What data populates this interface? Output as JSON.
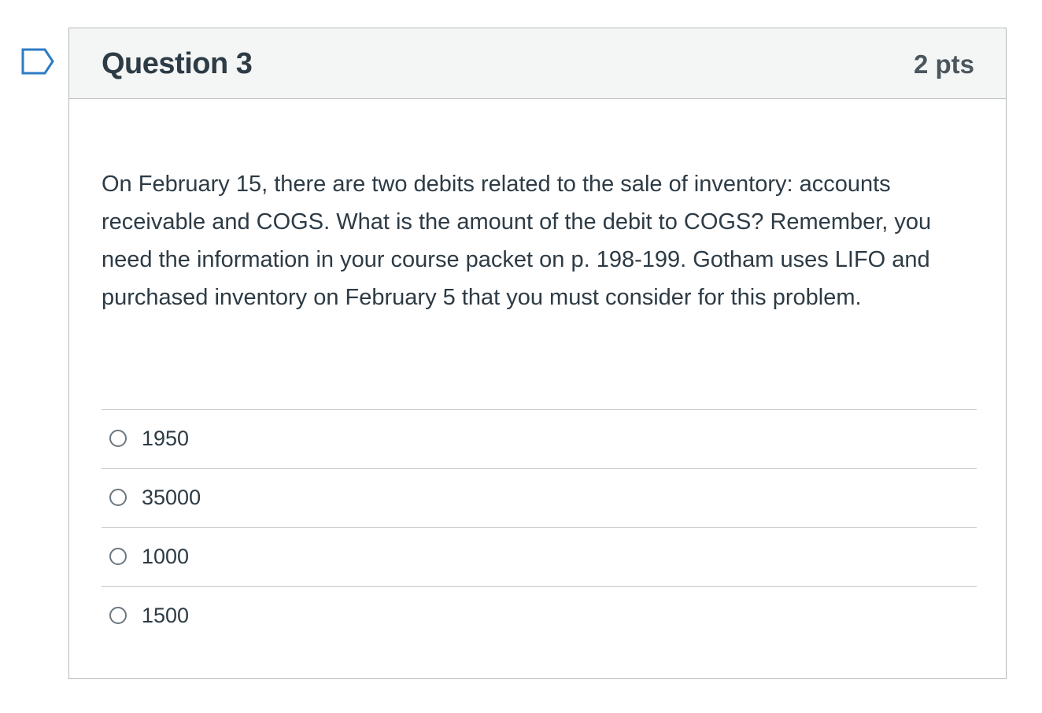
{
  "question": {
    "title": "Question 3",
    "points": "2 pts",
    "text": "On February 15, there are two debits related to the sale of inventory: accounts receivable and COGS. What is the amount of the debit to COGS? Remember, you need the information in your course packet on p. 198-199. Gotham uses LIFO and purchased inventory on February 5 that you must consider for this problem.",
    "answers": [
      {
        "label": "1950",
        "selected": false
      },
      {
        "label": "35000",
        "selected": false
      },
      {
        "label": "1000",
        "selected": false
      },
      {
        "label": "1500",
        "selected": false
      }
    ]
  },
  "colors": {
    "flag_icon": "#2d7bc4",
    "header_bg": "#f4f5f5",
    "border": "#b5b9bd",
    "text": "#2d3b45"
  }
}
